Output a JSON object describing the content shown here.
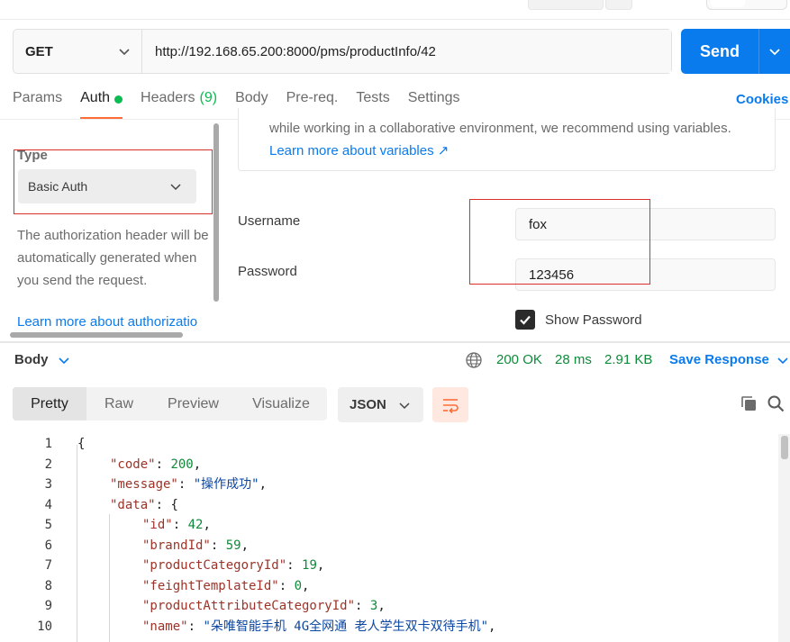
{
  "request": {
    "method": "GET",
    "url": "http://192.168.65.200:8000/pms/productInfo/42",
    "send_label": "Send"
  },
  "tabs": [
    {
      "label": "Params"
    },
    {
      "label": "Auth",
      "active": true,
      "indicator": "green-dot"
    },
    {
      "label": "Headers",
      "count": "(9)"
    },
    {
      "label": "Body"
    },
    {
      "label": "Pre-req."
    },
    {
      "label": "Tests"
    },
    {
      "label": "Settings"
    }
  ],
  "cookies_label": "Cookies",
  "auth": {
    "type_label": "Type",
    "type_value": "Basic Auth",
    "description": "The authorization header will be automatically generated when you send the request.",
    "learn_more": "Learn more about authorizatio",
    "info_text": "while working in a collaborative environment, we recommend using variables.",
    "info_link": "Learn more about variables ↗",
    "username_label": "Username",
    "username_value": "fox",
    "password_label": "Password",
    "password_value": "123456",
    "show_password_label": "Show Password",
    "show_password_checked": true
  },
  "response": {
    "body_label": "Body",
    "status": "200 OK",
    "time": "28 ms",
    "size": "2.91 KB",
    "save_label": "Save Response",
    "views": [
      "Pretty",
      "Raw",
      "Preview",
      "Visualize"
    ],
    "active_view": "Pretty",
    "format": "JSON"
  },
  "code_lines": [
    {
      "n": "1",
      "text": "{"
    },
    {
      "n": "2",
      "key": "\"code\"",
      "val": "200",
      "type": "num",
      "indent": 1,
      "trail": ","
    },
    {
      "n": "3",
      "key": "\"message\"",
      "val": "\"操作成功\"",
      "type": "str",
      "indent": 1,
      "trail": ","
    },
    {
      "n": "4",
      "key": "\"data\"",
      "val": "{",
      "type": "brace",
      "indent": 1,
      "trail": ""
    },
    {
      "n": "5",
      "key": "\"id\"",
      "val": "42",
      "type": "num",
      "indent": 2,
      "trail": ","
    },
    {
      "n": "6",
      "key": "\"brandId\"",
      "val": "59",
      "type": "num",
      "indent": 2,
      "trail": ","
    },
    {
      "n": "7",
      "key": "\"productCategoryId\"",
      "val": "19",
      "type": "num",
      "indent": 2,
      "trail": ","
    },
    {
      "n": "8",
      "key": "\"feightTemplateId\"",
      "val": "0",
      "type": "num",
      "indent": 2,
      "trail": ","
    },
    {
      "n": "9",
      "key": "\"productAttributeCategoryId\"",
      "val": "3",
      "type": "num",
      "indent": 2,
      "trail": ","
    },
    {
      "n": "10",
      "key": "\"name\"",
      "val": "\"朵唯智能手机 4G全网通 老人学生双卡双待手机\"",
      "type": "str",
      "indent": 2,
      "trail": ","
    }
  ],
  "colors": {
    "accent": "#097bed",
    "tab_underline": "#ff6c37",
    "status_green": "#0f8a3a",
    "annotation_red": "#d9302c"
  },
  "icons": {
    "method_dropdown": "chevron-down-icon",
    "send_dropdown": "chevron-down-icon",
    "network": "globe-icon",
    "wrap": "wrap-lines-icon",
    "copy": "copy-icon",
    "search": "search-icon",
    "checkbox": "check-icon"
  }
}
